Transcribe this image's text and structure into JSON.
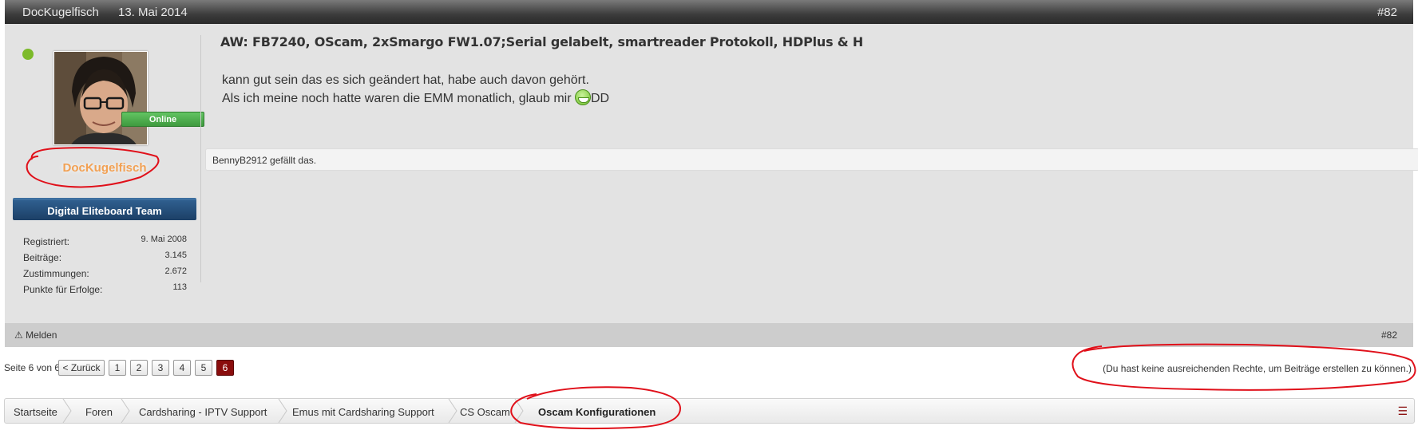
{
  "post": {
    "author": "DocKugelfisch",
    "date": "13. Mai 2014",
    "number": "#82",
    "title": "AW: FB7240, OScam, 2xSmargo FW1.07;Serial gelabelt, smartreader Protokoll, HDPlus & H",
    "line1": "kann gut sein das es sich geändert hat, habe auch davon gehört.",
    "line2_before": "Als ich meine noch hatte waren die EMM monatlich, glaub mir ",
    "line2_after": "DD",
    "emoji_icon": "grin-smiley-icon",
    "likes_text": "BennyB2912 gefällt das.",
    "report_label": "Melden"
  },
  "user": {
    "online_badge": "Online",
    "username": "DocKugelfisch",
    "team": "Digital Eliteboard Team",
    "stats": [
      {
        "label": "Registriert:",
        "value": "9. Mai 2008"
      },
      {
        "label": "Beiträge:",
        "value": "3.145"
      },
      {
        "label": "Zustimmungen:",
        "value": "2.672"
      },
      {
        "label": "Punkte für Erfolge:",
        "value": "113"
      }
    ]
  },
  "pagination": {
    "label": "Seite 6 von 6",
    "prev": "< Zurück",
    "pages": [
      "1",
      "2",
      "3",
      "4",
      "5",
      "6"
    ],
    "current": "6"
  },
  "no_rights": "(Du hast keine ausreichenden Rechte, um Beiträge erstellen zu können.)",
  "breadcrumb": [
    "Startseite",
    "Foren",
    "Cardsharing - IPTV Support",
    "Emus mit Cardsharing Support",
    "CS Oscam",
    "Oscam Konfigurationen"
  ],
  "colors": {
    "accent": "#8a0d0d",
    "online": "#7cba2a",
    "username": "#f2a154",
    "team_badge": "#1c3f66",
    "annotation": "#e0101a"
  }
}
